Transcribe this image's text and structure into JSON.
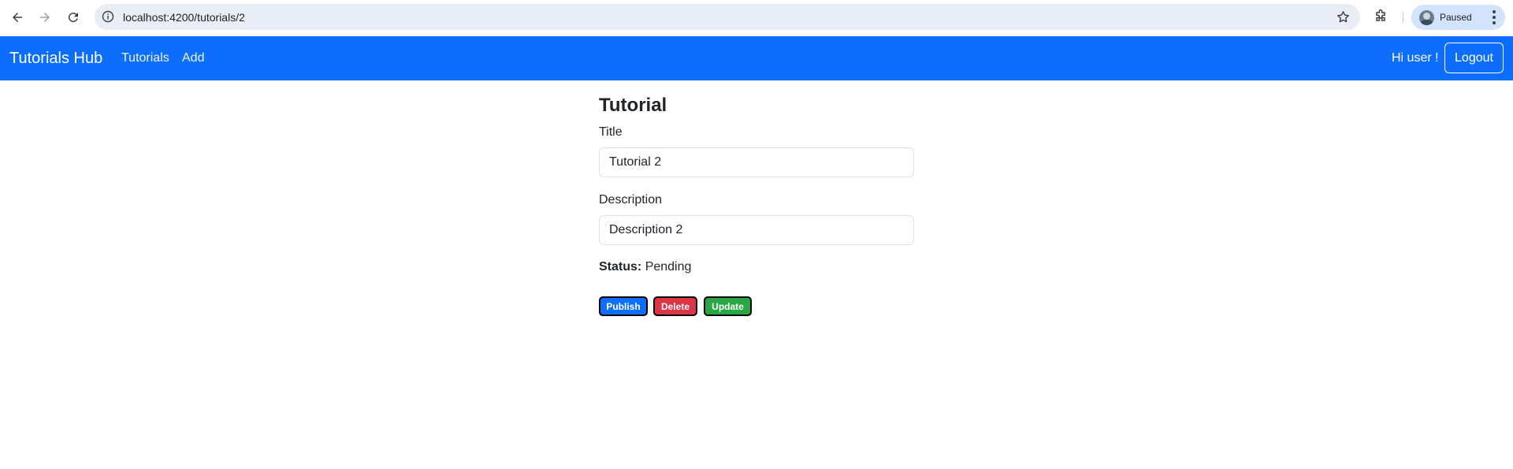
{
  "browser": {
    "url": "localhost:4200/tutorials/2",
    "profile_label": "Paused"
  },
  "navbar": {
    "brand": "Tutorials Hub",
    "links": [
      {
        "label": "Tutorials"
      },
      {
        "label": "Add"
      }
    ],
    "greeting": "Hi user !",
    "logout_label": "Logout",
    "bg_color": "#0d6efd"
  },
  "tutorial": {
    "heading": "Tutorial",
    "title_label": "Title",
    "title_value": "Tutorial 2",
    "description_label": "Description",
    "description_value": "Description 2",
    "status_key": "Status:",
    "status_value": "Pending"
  },
  "actions": {
    "publish_label": "Publish",
    "delete_label": "Delete",
    "update_label": "Update",
    "publish_color": "#0d6efd",
    "delete_color": "#dc3545",
    "update_color": "#28a745"
  }
}
